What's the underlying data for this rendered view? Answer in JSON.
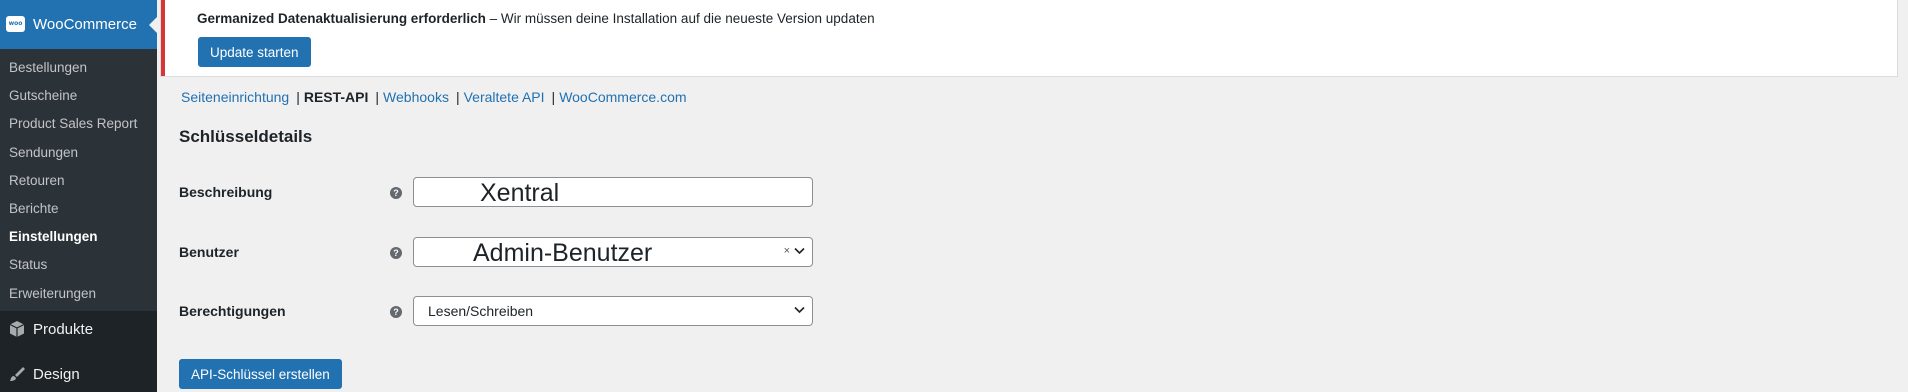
{
  "sidebar": {
    "woocommerce_label": "WooCommerce",
    "woo_logo_text": "woo",
    "submenu": [
      {
        "label": "Bestellungen",
        "current": false
      },
      {
        "label": "Gutscheine",
        "current": false
      },
      {
        "label": "Product Sales Report",
        "current": false
      },
      {
        "label": "Sendungen",
        "current": false
      },
      {
        "label": "Retouren",
        "current": false
      },
      {
        "label": "Berichte",
        "current": false
      },
      {
        "label": "Einstellungen",
        "current": true
      },
      {
        "label": "Status",
        "current": false
      },
      {
        "label": "Erweiterungen",
        "current": false
      }
    ],
    "products_label": "Produkte",
    "design_label": "Design"
  },
  "notice": {
    "title": "Germanized Datenaktualisierung erforderlich",
    "message": " – Wir müssen deine Installation auf die neueste Version updaten",
    "button": "Update starten"
  },
  "subnav": {
    "items": [
      "Seiteneinrichtung",
      "REST-API",
      "Webhooks",
      "Veraltete API",
      "WooCommerce.com"
    ],
    "separator": "|",
    "current": "REST-API"
  },
  "section_title": "Schlüsseldetails",
  "form": {
    "description_label": "Beschreibung",
    "description_value": "Xentral",
    "user_label": "Benutzer",
    "user_value": "Admin-Benutzer",
    "permissions_label": "Berechtigungen",
    "permissions_value": "Lesen/Schreiben",
    "help_glyph": "?",
    "clear_glyph": "×",
    "submit_label": "API-Schlüssel erstellen"
  },
  "colors": {
    "accent": "#2271b1",
    "sidebar_bg": "#1d2327",
    "submenu_bg": "#2c3338",
    "notice_border": "#d63638"
  }
}
